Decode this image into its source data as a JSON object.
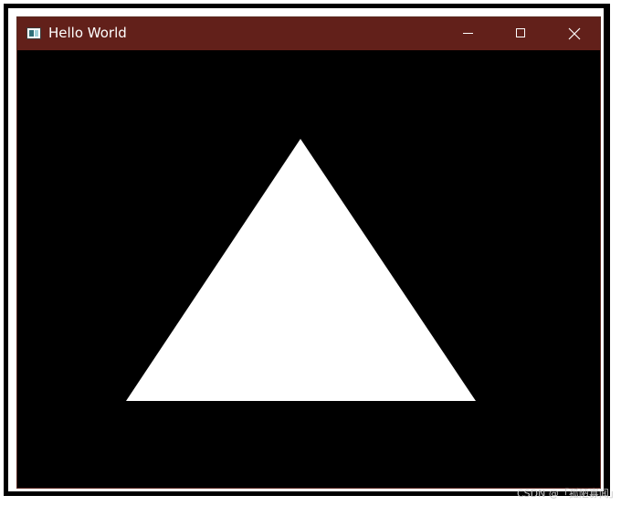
{
  "window": {
    "title": "Hello World",
    "icon": "app-window-icon",
    "titlebar_color": "#62201a",
    "controls": {
      "minimize_icon": "minimize-icon",
      "maximize_icon": "maximize-icon",
      "close_icon": "close-icon"
    }
  },
  "canvas": {
    "background": "#000000",
    "shape": "triangle",
    "shape_color": "#ffffff"
  },
  "watermark": {
    "text": "CSDN @「孤陋寡闻」"
  }
}
